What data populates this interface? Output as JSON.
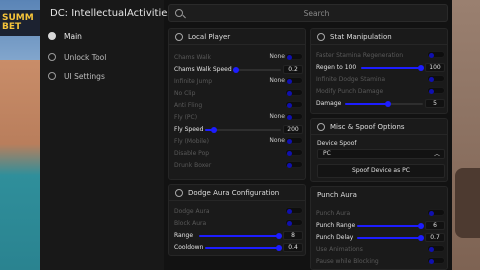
{
  "game": {
    "ad_text": "SUMM\nBET"
  },
  "app": {
    "title": "DC: IntellectualActivities"
  },
  "nav": [
    {
      "label": "Main",
      "icon": "home-icon",
      "active": true
    },
    {
      "label": "Unlock Tool",
      "icon": "unlock-icon",
      "active": false
    },
    {
      "label": "UI Settings",
      "icon": "settings-icon",
      "active": false
    }
  ],
  "search": {
    "placeholder": "Search"
  },
  "local_player": {
    "title": "Local Player",
    "rows": [
      {
        "label": "Chams Walk",
        "value": "None"
      },
      {
        "label": "Chams Walk Speed",
        "value": "0.2"
      },
      {
        "label": "Infinite Jump",
        "value": "None"
      },
      {
        "label": "No Clip"
      },
      {
        "label": "Anti Fling"
      },
      {
        "label": "Fly (PC)",
        "value": "None"
      },
      {
        "label": "Fly Speed",
        "value": "200"
      },
      {
        "label": "Fly (Mobile)",
        "value": "None"
      },
      {
        "label": "Disable Pop"
      },
      {
        "label": "Drunk Boxer"
      }
    ]
  },
  "dodge_aura": {
    "title": "Dodge Aura Configuration",
    "rows": [
      {
        "label": "Dodge Aura"
      },
      {
        "label": "Block Aura"
      },
      {
        "label": "Range",
        "value": "8"
      },
      {
        "label": "Cooldown",
        "value": "0.4"
      }
    ]
  },
  "stat_manipulation": {
    "title": "Stat Manipulation",
    "rows": [
      {
        "label": "Faster Stamina Regeneration"
      },
      {
        "label": "Regen to 100",
        "value": "100"
      },
      {
        "label": "Infinite Dodge Stamina"
      },
      {
        "label": "Modify Punch Damage"
      },
      {
        "label": "Damage",
        "value": "5"
      }
    ]
  },
  "misc": {
    "title": "Misc & Spoof Options",
    "device_spoof_label": "Device Spoof",
    "device_spoof_value": "PC",
    "spoof_button": "Spoof Device as PC"
  },
  "punch_aura": {
    "title": "Punch Aura",
    "rows": [
      {
        "label": "Punch Aura"
      },
      {
        "label": "Punch Range",
        "value": "6"
      },
      {
        "label": "Punch Delay",
        "value": "0.7"
      },
      {
        "label": "Use Animations"
      },
      {
        "label": "Pause while Blocking"
      }
    ]
  },
  "colors": {
    "accent": "#1d1dff",
    "bg": "#121212",
    "panel": "#1a1a1a"
  }
}
